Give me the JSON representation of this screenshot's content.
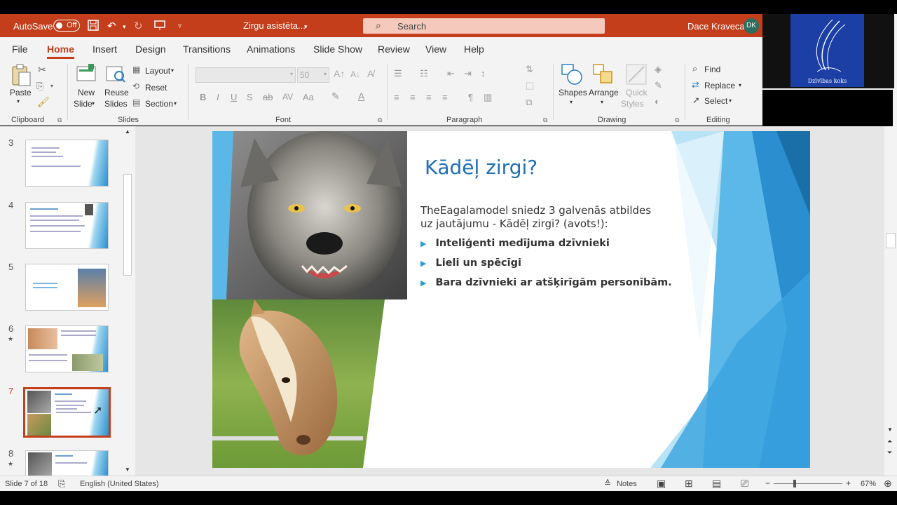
{
  "titlebar": {
    "autosave_label": "AutoSave",
    "autosave_state": "Off",
    "doc_title": "Zirgu asistēta...",
    "search_placeholder": "Search",
    "user_name": "Dace Kraveca",
    "user_initials": "DK"
  },
  "menu": {
    "tabs": [
      "File",
      "Home",
      "Insert",
      "Design",
      "Transitions",
      "Animations",
      "Slide Show",
      "Review",
      "View",
      "Help"
    ],
    "active_tab": "Home"
  },
  "ribbon": {
    "clipboard": {
      "label": "Clipboard",
      "paste": "Paste"
    },
    "slides": {
      "label": "Slides",
      "new_slide_1": "New",
      "new_slide_2": "Slide",
      "reuse_1": "Reuse",
      "reuse_2": "Slides",
      "layout": "Layout",
      "reset": "Reset",
      "section": "Section"
    },
    "font": {
      "label": "Font",
      "size": "50"
    },
    "paragraph": {
      "label": "Paragraph"
    },
    "drawing": {
      "label": "Drawing",
      "shapes": "Shapes",
      "arrange": "Arrange",
      "quick_1": "Quick",
      "quick_2": "Styles"
    },
    "editing": {
      "label": "Editing",
      "find": "Find",
      "replace": "Replace",
      "select": "Select"
    }
  },
  "thumbnails": {
    "numbers": [
      "3",
      "4",
      "5",
      "6",
      "7",
      "8"
    ],
    "selected": "7"
  },
  "slide": {
    "title": "Kādēļ zirgi?",
    "body": "TheEagalamodel sniedz 3 galvenās atbildes uz jautājumu - Kādēļ zirgi? (avots!):",
    "bullets": [
      "Inteliģenti medījuma dzīvnieki",
      "Lieli un spēcīgi",
      "Bara dzīvnieki ar atšķirīgām personībām."
    ]
  },
  "video": {
    "logo_text": "Dzīvības koks"
  },
  "statusbar": {
    "slide_info": "Slide 7 of 18",
    "language": "English (United States)",
    "notes": "Notes",
    "zoom": "67%"
  },
  "colors": {
    "accent": "#c43e1c",
    "title_blue": "#1f6fb5",
    "bullet_blue": "#2a9fd6"
  }
}
